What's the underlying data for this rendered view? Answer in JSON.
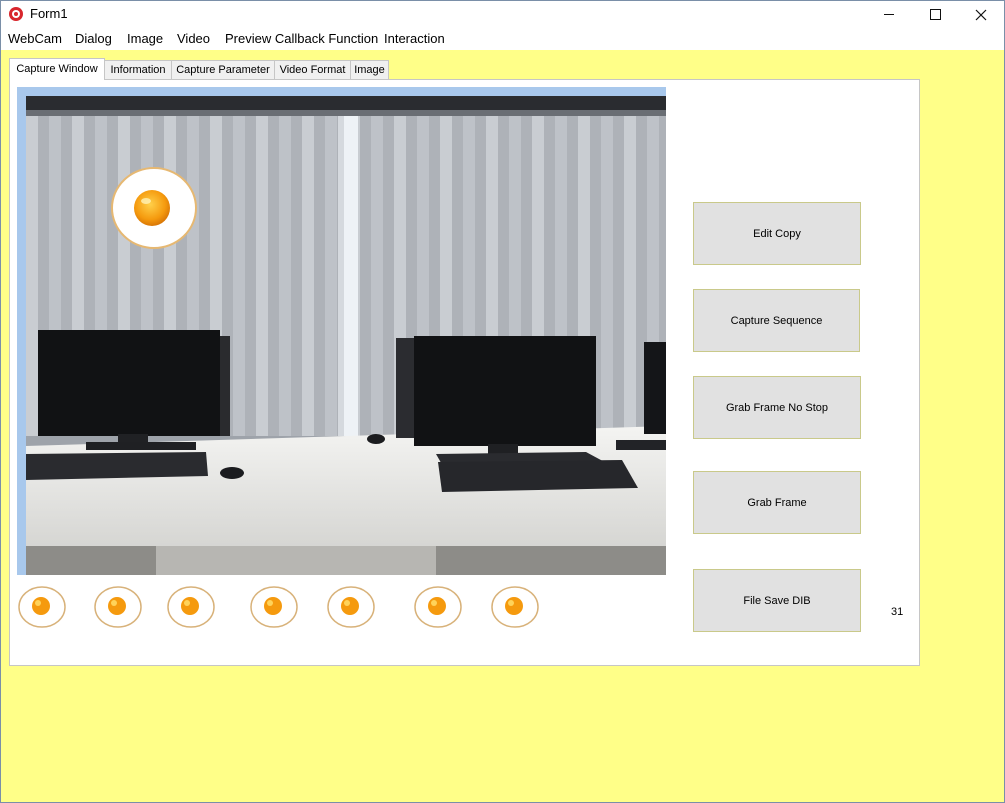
{
  "window": {
    "title": "Form1"
  },
  "menu": [
    "WebCam",
    "Dialog",
    "Image",
    "Video",
    "Preview Callback Function",
    "Interaction"
  ],
  "tabs": [
    "Capture Window",
    "Information",
    "Capture Parameter",
    "Video Format",
    "Image"
  ],
  "active_tab": "Capture Window",
  "buttons": {
    "edit_copy": "Edit Copy",
    "capture_sequence": "Capture Sequence",
    "grab_frame_no_stop": "Grab Frame No Stop",
    "grab_frame": "Grab Frame",
    "file_save_dib": "File Save DIB"
  },
  "counter": "31",
  "thumbnail_count": 7,
  "colors": {
    "form_background": "#ffff88",
    "preview_border": "#a8c8ec",
    "button_face": "#e1e1e1",
    "close_glyph": "#111111"
  },
  "icons": {
    "app": "app-icon",
    "minimize": "minimize-icon",
    "maximize": "maximize-icon",
    "close": "close-icon"
  }
}
